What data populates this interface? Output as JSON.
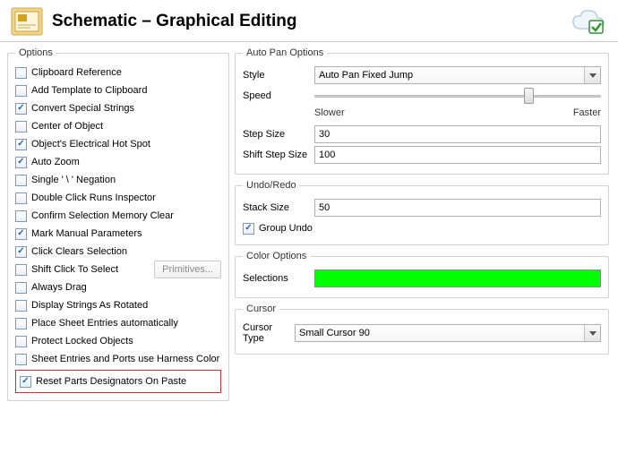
{
  "header": {
    "title": "Schematic – Graphical Editing"
  },
  "options": {
    "legend": "Options",
    "items": [
      {
        "label": "Clipboard Reference",
        "checked": false
      },
      {
        "label": "Add Template to Clipboard",
        "checked": false
      },
      {
        "label": "Convert Special Strings",
        "checked": true
      },
      {
        "label": "Center of Object",
        "checked": false
      },
      {
        "label": "Object's Electrical Hot Spot",
        "checked": true
      },
      {
        "label": "Auto Zoom",
        "checked": true
      },
      {
        "label": "Single ' \\ ' Negation",
        "checked": false
      },
      {
        "label": "Double Click Runs Inspector",
        "checked": false
      },
      {
        "label": "Confirm Selection Memory Clear",
        "checked": false
      },
      {
        "label": "Mark Manual Parameters",
        "checked": true
      },
      {
        "label": "Click Clears Selection",
        "checked": true
      },
      {
        "label": "Shift Click To Select",
        "checked": false
      },
      {
        "label": "Always Drag",
        "checked": false
      },
      {
        "label": "Display Strings As Rotated",
        "checked": false
      },
      {
        "label": "Place Sheet Entries automatically",
        "checked": false
      },
      {
        "label": "Protect Locked Objects",
        "checked": false
      },
      {
        "label": "Sheet Entries and Ports use Harness Color",
        "checked": false
      },
      {
        "label": "Reset Parts Designators On Paste",
        "checked": true
      }
    ],
    "primitives_btn": "Primitives..."
  },
  "autopan": {
    "legend": "Auto Pan Options",
    "style_label": "Style",
    "style_value": "Auto Pan Fixed Jump",
    "speed_label": "Speed",
    "slower": "Slower",
    "faster": "Faster",
    "step_label": "Step Size",
    "step_value": "30",
    "shift_label": "Shift Step Size",
    "shift_value": "100"
  },
  "undo": {
    "legend": "Undo/Redo",
    "stack_label": "Stack Size",
    "stack_value": "50",
    "group_label": "Group Undo",
    "group_checked": true
  },
  "color": {
    "legend": "Color Options",
    "selections_label": "Selections",
    "selections_color": "#00ff00"
  },
  "cursor": {
    "legend": "Cursor",
    "type_label": "Cursor Type",
    "type_value": "Small Cursor 90"
  }
}
